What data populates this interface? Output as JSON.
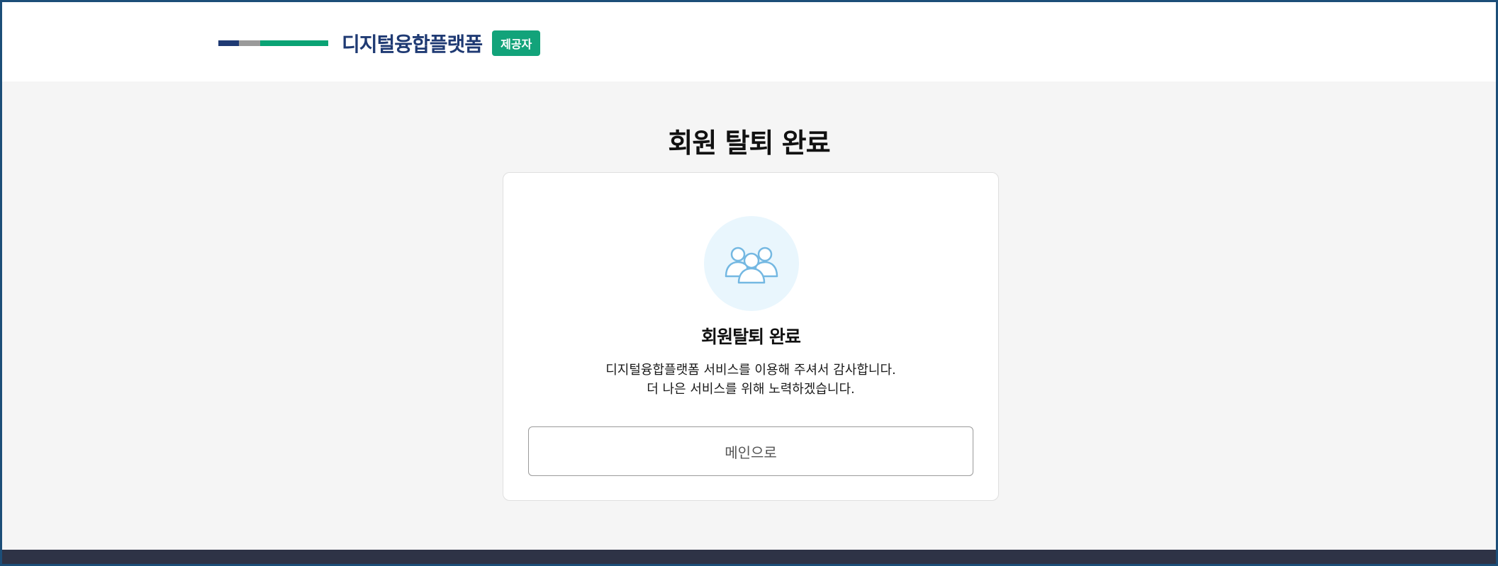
{
  "header": {
    "brand_name": "디지털융합플랫폼",
    "badge_label": "제공자"
  },
  "page_title": "회원 탈퇴 완료",
  "card": {
    "icon": "users-group-icon",
    "title": "회원탈퇴 완료",
    "message_line1": "디지털융합플랫폼 서비스를 이용해 주셔서 감사합니다.",
    "message_line2": "더 나은 서비스를 위해 노력하겠습니다.",
    "button_label": "메인으로"
  },
  "colors": {
    "brand_navy": "#1f3a73",
    "brand_gray": "#9a9a9a",
    "brand_green": "#0aa374",
    "badge_green": "#12a37a",
    "icon_bg": "#e9f6fd",
    "icon_stroke": "#74b8e2",
    "footer": "#2e3346",
    "page_bg": "#f5f5f5"
  }
}
